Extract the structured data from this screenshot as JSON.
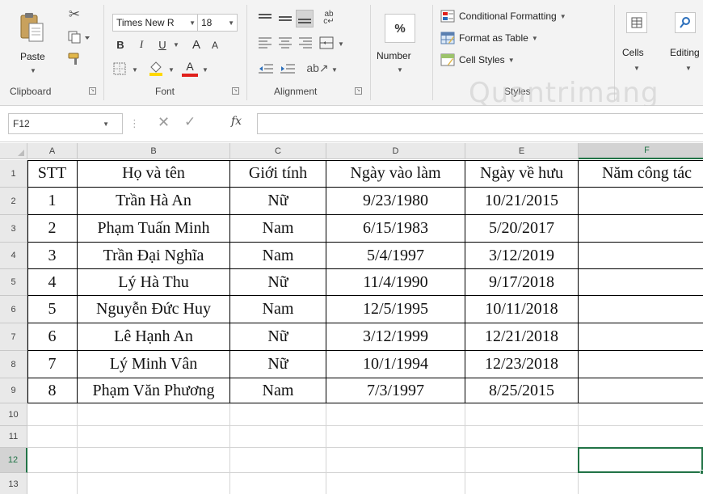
{
  "ribbon": {
    "clipboard": {
      "label": "Clipboard",
      "paste_label": "Paste"
    },
    "font": {
      "label": "Font",
      "font_name": "Times New R",
      "font_size": "18",
      "bold": "B",
      "italic": "I",
      "underline": "U",
      "grow": "A",
      "shrink": "A",
      "font_color_letter": "A"
    },
    "alignment": {
      "label": "Alignment"
    },
    "number": {
      "label": "Number",
      "symbol": "%"
    },
    "styles": {
      "label": "Styles",
      "conditional_formatting": "Conditional Formatting",
      "format_as_table": "Format as Table",
      "cell_styles": "Cell Styles"
    },
    "cells": {
      "label": "Cells"
    },
    "editing": {
      "label": "Editing"
    }
  },
  "formula_bar": {
    "name_box": "F12",
    "fx": "fx",
    "value": ""
  },
  "watermark": "Quantrimang",
  "sheet": {
    "columns": [
      "A",
      "B",
      "C",
      "D",
      "E",
      "F"
    ],
    "selected_column": "F",
    "selected_row": "12",
    "header_row": [
      "STT",
      "Họ và tên",
      "Giới tính",
      "Ngày vào làm",
      "Ngày về hưu",
      "Năm công tác"
    ],
    "rows": [
      [
        "1",
        "Trần Hà An",
        "Nữ",
        "9/23/1980",
        "10/21/2015",
        ""
      ],
      [
        "2",
        "Phạm Tuấn Minh",
        "Nam",
        "6/15/1983",
        "5/20/2017",
        ""
      ],
      [
        "3",
        "Trần Đại Nghĩa",
        "Nam",
        "5/4/1997",
        "3/12/2019",
        ""
      ],
      [
        "4",
        "Lý Hà Thu",
        "Nữ",
        "11/4/1990",
        "9/17/2018",
        ""
      ],
      [
        "5",
        "Nguyễn Đức Huy",
        "Nam",
        "12/5/1995",
        "10/11/2018",
        ""
      ],
      [
        "6",
        "Lê Hạnh An",
        "Nữ",
        "3/12/1999",
        "12/21/2018",
        ""
      ],
      [
        "7",
        "Lý Minh Vân",
        "Nữ",
        "10/1/1994",
        "12/23/2018",
        ""
      ],
      [
        "8",
        "Phạm Văn Phương",
        "Nam",
        "7/3/1997",
        "8/25/2015",
        ""
      ]
    ],
    "row_numbers": [
      "1",
      "2",
      "3",
      "4",
      "5",
      "6",
      "7",
      "8",
      "9",
      "10",
      "11",
      "12",
      "13"
    ]
  },
  "colors": {
    "accent": "#217346",
    "font_color_swatch": "#e0201b",
    "highlight_swatch": "#ffd800"
  },
  "icons": {
    "cut": "scissors-icon",
    "copy": "copy-icon",
    "format_painter": "paintbrush-icon",
    "borders": "borders-icon",
    "fill": "fill-bucket-icon",
    "wrap": "wrap-text-icon",
    "merge": "merge-center-icon",
    "orientation": "orientation-icon",
    "indent_decrease": "indent-decrease-icon",
    "indent_increase": "indent-increase-icon",
    "cells": "cells-icon",
    "editing": "search-icon"
  }
}
